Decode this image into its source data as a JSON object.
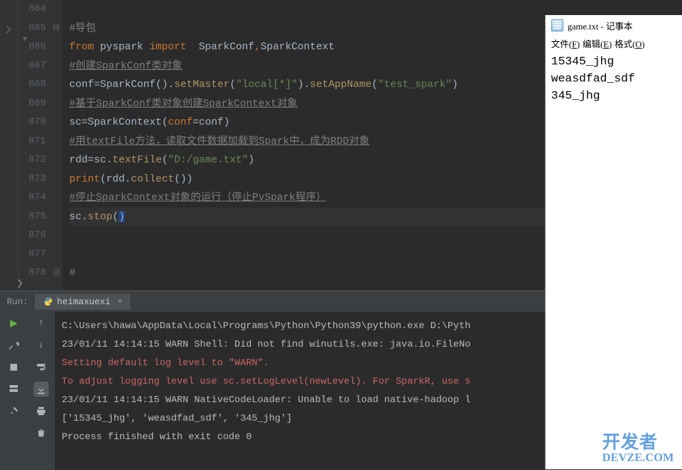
{
  "editor": {
    "lines": [
      {
        "num": "864",
        "tokens": []
      },
      {
        "num": "865",
        "tokens": [
          {
            "t": "#导包",
            "cls": "tok-c"
          }
        ]
      },
      {
        "num": "866",
        "tokens": [
          {
            "t": "from ",
            "cls": "tok-kw"
          },
          {
            "t": "pyspark ",
            "cls": "tok-id"
          },
          {
            "t": "import  ",
            "cls": "tok-kw"
          },
          {
            "t": "SparkConf",
            "cls": "tok-id"
          },
          {
            "t": ",",
            "cls": "tok-kw"
          },
          {
            "t": "SparkContext",
            "cls": "tok-id"
          }
        ]
      },
      {
        "num": "867",
        "tokens": [
          {
            "t": "#创建SparkConf类对象",
            "cls": "tok-cu"
          }
        ]
      },
      {
        "num": "868",
        "tokens": [
          {
            "t": "conf",
            "cls": "tok-id"
          },
          {
            "t": "=",
            "cls": "tok-id"
          },
          {
            "t": "SparkConf",
            "cls": "tok-id"
          },
          {
            "t": "()",
            "cls": "tok-par"
          },
          {
            "t": ".",
            "cls": "tok-id"
          },
          {
            "t": "setMaster",
            "cls": "tok-fn"
          },
          {
            "t": "(",
            "cls": "tok-par"
          },
          {
            "t": "\"local[*]\"",
            "cls": "tok-str"
          },
          {
            "t": ")",
            "cls": "tok-par"
          },
          {
            "t": ".",
            "cls": "tok-id"
          },
          {
            "t": "setAppName",
            "cls": "tok-fn"
          },
          {
            "t": "(",
            "cls": "tok-par"
          },
          {
            "t": "\"test_spark\"",
            "cls": "tok-str"
          },
          {
            "t": ")",
            "cls": "tok-par"
          }
        ]
      },
      {
        "num": "869",
        "tokens": [
          {
            "t": "#基于SparkConf类对象创建SparkContext对象",
            "cls": "tok-cu"
          }
        ]
      },
      {
        "num": "870",
        "tokens": [
          {
            "t": "sc",
            "cls": "tok-id"
          },
          {
            "t": "=",
            "cls": "tok-id"
          },
          {
            "t": "SparkContext",
            "cls": "tok-id"
          },
          {
            "t": "(",
            "cls": "tok-par"
          },
          {
            "t": "conf",
            "cls": "tok-kw"
          },
          {
            "t": "=",
            "cls": "tok-id"
          },
          {
            "t": "conf",
            "cls": "tok-id"
          },
          {
            "t": ")",
            "cls": "tok-par"
          }
        ]
      },
      {
        "num": "871",
        "tokens": [
          {
            "t": "#用textFile方法，读取文件数据加载到Spark中，成为RDD对象",
            "cls": "tok-cu"
          }
        ]
      },
      {
        "num": "872",
        "tokens": [
          {
            "t": "rdd",
            "cls": "tok-id"
          },
          {
            "t": "=",
            "cls": "tok-id"
          },
          {
            "t": "sc",
            "cls": "tok-id"
          },
          {
            "t": ".",
            "cls": "tok-id"
          },
          {
            "t": "textFile",
            "cls": "tok-fn"
          },
          {
            "t": "(",
            "cls": "tok-par"
          },
          {
            "t": "\"D:/game.txt\"",
            "cls": "tok-str"
          },
          {
            "t": ")",
            "cls": "tok-par"
          }
        ]
      },
      {
        "num": "873",
        "tokens": [
          {
            "t": "print",
            "cls": "tok-kw"
          },
          {
            "t": "(",
            "cls": "tok-par"
          },
          {
            "t": "rdd",
            "cls": "tok-id"
          },
          {
            "t": ".",
            "cls": "tok-id"
          },
          {
            "t": "collect",
            "cls": "tok-fn"
          },
          {
            "t": "()",
            "cls": "tok-par"
          },
          {
            "t": ")",
            "cls": "tok-par"
          }
        ]
      },
      {
        "num": "874",
        "tokens": [
          {
            "t": "#停止SparkContext对象的运行（停止PySpark程序）",
            "cls": "tok-cu"
          }
        ]
      },
      {
        "num": "875",
        "current": true,
        "tokens": [
          {
            "t": "sc",
            "cls": "tok-id"
          },
          {
            "t": ".",
            "cls": "tok-id"
          },
          {
            "t": "stop",
            "cls": "tok-fn"
          },
          {
            "t": "(",
            "cls": "tok-par"
          },
          {
            "t": ")",
            "cls": "tok-cur"
          }
        ]
      },
      {
        "num": "876",
        "tokens": []
      },
      {
        "num": "877",
        "tokens": []
      },
      {
        "num": "878",
        "tokens": [
          {
            "t": "#",
            "cls": "tok-c"
          }
        ]
      }
    ]
  },
  "run": {
    "label": "Run:",
    "tab_name": "heimaxuexi",
    "console": [
      {
        "text": "C:\\Users\\hawa\\AppData\\Local\\Programs\\Python\\Python39\\python.exe D:\\Pyth",
        "cls": "grey"
      },
      {
        "text": "23/01/11 14:14:15 WARN Shell: Did not find winutils.exe: java.io.FileNo",
        "cls": "grey"
      },
      {
        "text": "Setting default log level to \"WARN\".",
        "cls": "red"
      },
      {
        "text": "To adjust logging level use sc.setLogLevel(newLevel). For SparkR, use s",
        "cls": "red"
      },
      {
        "text": "23/01/11 14:14:15 WARN NativeCodeLoader: Unable to load native-hadoop l",
        "cls": "grey"
      },
      {
        "text": "['15345_jhg', 'weasdfad_sdf', '345_jhg']",
        "cls": "grey"
      },
      {
        "text": "",
        "cls": "grey"
      },
      {
        "text": "Process finished with exit code 0",
        "cls": "grey"
      }
    ]
  },
  "notepad": {
    "title": "game.txt - 记事本",
    "menu": {
      "file": "文件(F)",
      "edit": "编辑(E)",
      "format": "格式(O)"
    },
    "content": [
      "15345_jhg",
      "weasdfad_sdf",
      "345_jhg"
    ]
  },
  "watermark": {
    "cn": "开发者",
    "en": "DEVZE.COM"
  }
}
